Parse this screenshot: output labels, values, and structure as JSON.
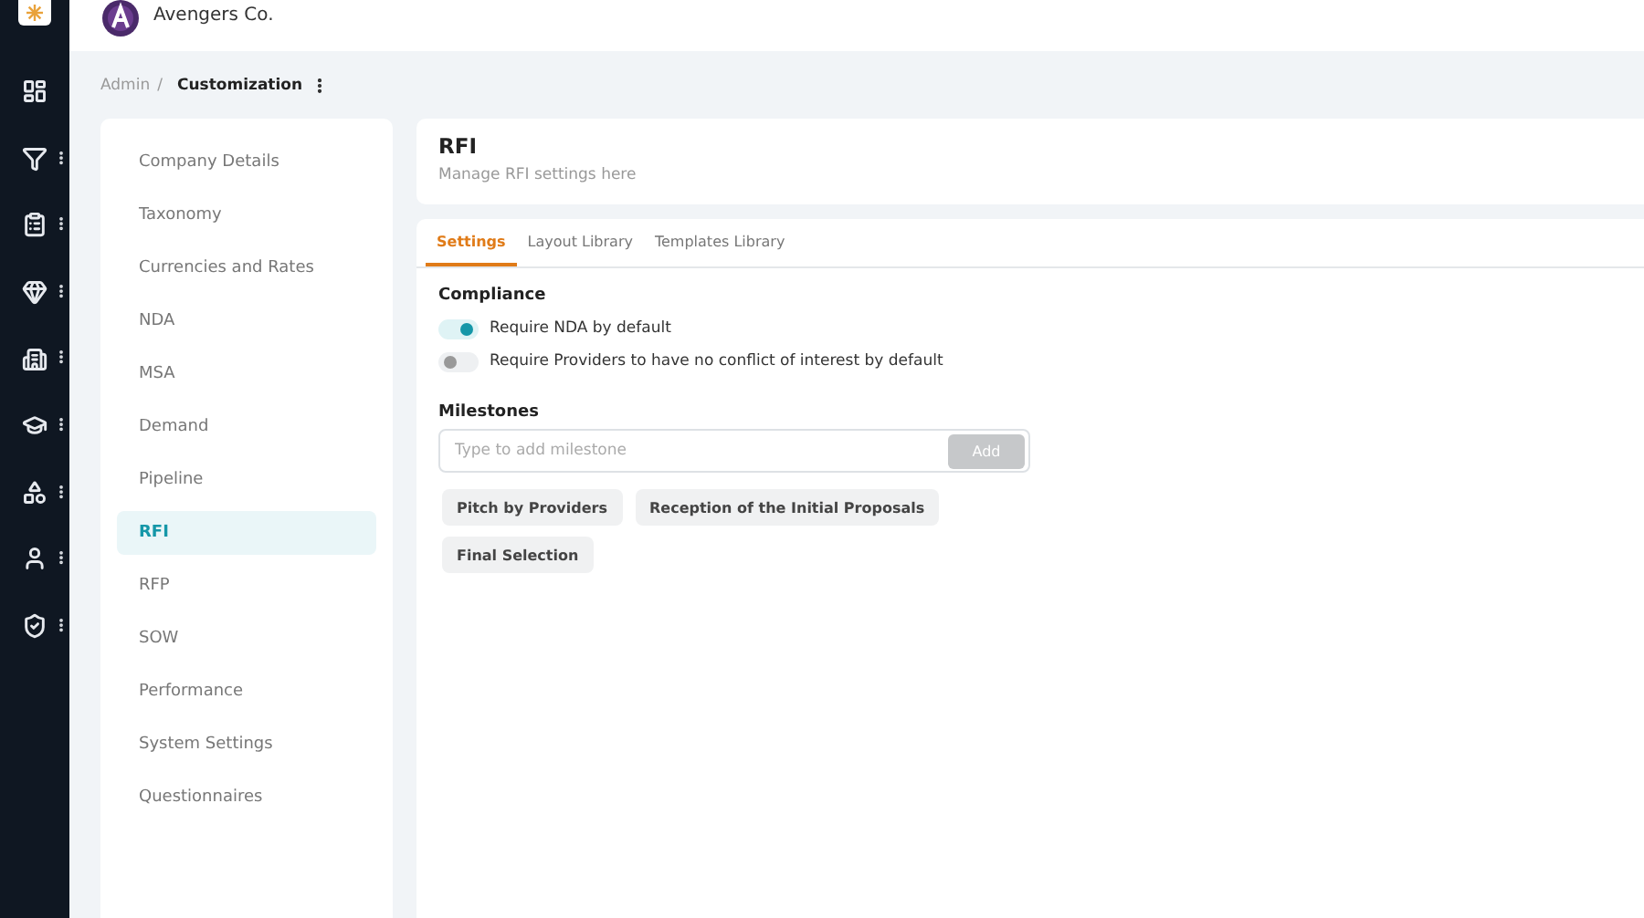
{
  "header": {
    "company": "Avengers Co."
  },
  "rail": [
    {
      "menu": false
    },
    {
      "menu": true
    },
    {
      "menu": true
    },
    {
      "menu": true
    },
    {
      "menu": true
    },
    {
      "menu": true
    },
    {
      "menu": true
    },
    {
      "menu": true
    },
    {
      "menu": true
    }
  ],
  "breadcrumb": {
    "parent": "Admin",
    "separator": "/",
    "current": "Customization"
  },
  "nav": [
    {
      "label": "Company Details",
      "selected": false
    },
    {
      "label": "Taxonomy",
      "selected": false
    },
    {
      "label": "Currencies and Rates",
      "selected": false
    },
    {
      "label": "NDA",
      "selected": false
    },
    {
      "label": "MSA",
      "selected": false
    },
    {
      "label": "Demand",
      "selected": false
    },
    {
      "label": "Pipeline",
      "selected": false
    },
    {
      "label": "RFI",
      "selected": true
    },
    {
      "label": "RFP",
      "selected": false
    },
    {
      "label": "SOW",
      "selected": false
    },
    {
      "label": "Performance",
      "selected": false
    },
    {
      "label": "System Settings",
      "selected": false
    },
    {
      "label": "Questionnaires",
      "selected": false
    }
  ],
  "page": {
    "title": "RFI",
    "subtitle": "Manage RFI settings here"
  },
  "tabs": [
    {
      "label": "Settings",
      "selected": true
    },
    {
      "label": "Layout Library",
      "selected": false
    },
    {
      "label": "Templates Library",
      "selected": false
    }
  ],
  "compliance": {
    "heading": "Compliance",
    "toggles": [
      {
        "label": "Require NDA by default",
        "on": true
      },
      {
        "label": "Require Providers to have no conflict of interest by default",
        "on": false
      }
    ]
  },
  "milestones": {
    "heading": "Milestones",
    "placeholder": "Type to add milestone",
    "add_button": {
      "label": "Add",
      "disabled": true
    },
    "items": [
      "Pitch by Providers",
      "Reception of the Initial Proposals",
      "Final Selection"
    ]
  }
}
